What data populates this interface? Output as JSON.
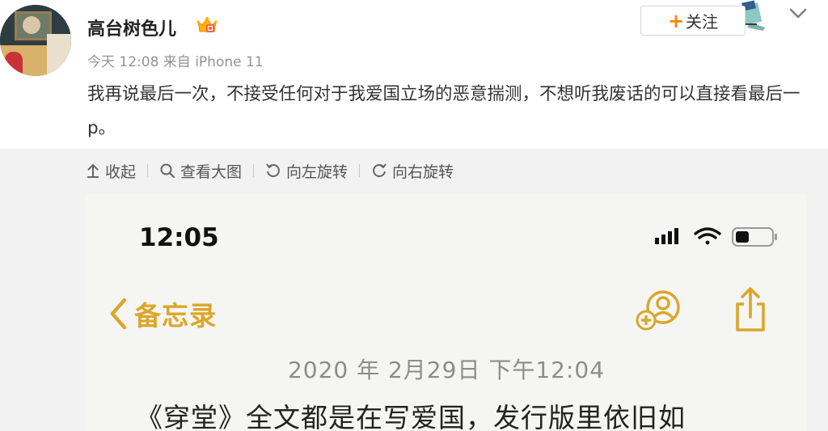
{
  "post": {
    "username": "高台树色儿",
    "meta": "今天 12:08 来自 iPhone 11",
    "text": "我再说最后一次，不接受任何对于我爱国立场的恶意揣测，不想听我废话的可以直接看最后一p。",
    "follow_label": "关注",
    "follow_plus": "+"
  },
  "toolbar": {
    "collapse": "收起",
    "view_large": "查看大图",
    "rotate_left": "向左旋转",
    "rotate_right": "向右旋转"
  },
  "screenshot": {
    "time": "12:05",
    "back_label": "备忘录",
    "date": "2020 年 2月29日 下午12:04",
    "body": "《穿堂》全文都是在写爱国，发行版里依旧如"
  },
  "icons": {
    "vip": "vip-crown-icon",
    "menu": "chevron-down-icon",
    "collapse": "arrow-up-icon",
    "view_large": "magnifier-icon",
    "rotate_left": "rotate-left-icon",
    "rotate_right": "rotate-right-icon",
    "signal": "cellular-signal-icon",
    "wifi": "wifi-icon",
    "battery": "battery-icon",
    "back": "chevron-left-icon",
    "share_person": "add-person-icon",
    "share": "share-icon"
  },
  "colors": {
    "follow_plus": "#ff8200",
    "notes_accent": "#dba62a",
    "muted": "#939393",
    "panel_bg": "#f2f2f2"
  }
}
